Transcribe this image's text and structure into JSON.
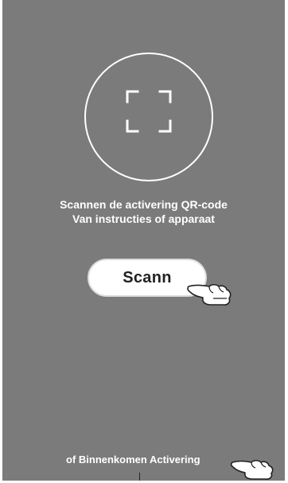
{
  "scan": {
    "instruction_line1": "Scannen de activering QR-code",
    "instruction_line2": "Van instructies of apparaat",
    "button_label": "Scann"
  },
  "manual": {
    "link_text": "of Binnenkomen Activering"
  },
  "colors": {
    "screen_background": "#7b7b7b",
    "foreground": "#ffffff"
  },
  "icons": {
    "scan_icon": "qr-scan-frame",
    "pointer_icon": "pointing-hand"
  }
}
